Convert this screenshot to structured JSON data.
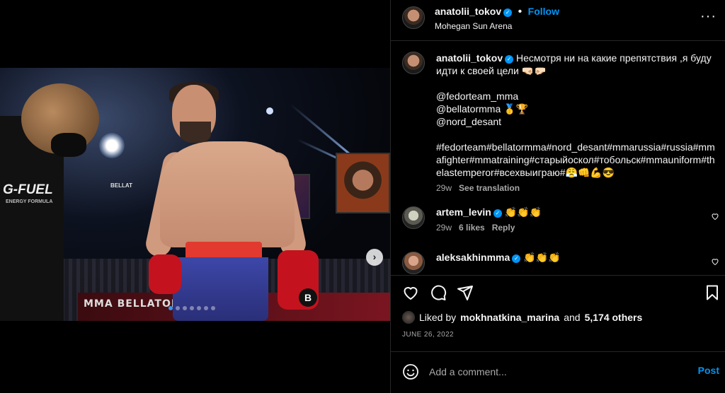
{
  "post": {
    "author": "anatolii_tokov",
    "location": "Mohegan Sun Arena",
    "follow_label": "Follow",
    "more_label": "···"
  },
  "photo": {
    "banner_text": "MMA BELLATOR MM",
    "coach_logo": "G-FUEL",
    "coach_sub": "ENERGY FORMULA",
    "arena_sign": "BELLAT",
    "glove_logo": "B",
    "next_label": "›",
    "carousel": {
      "count": 7,
      "active_index": 0
    }
  },
  "caption": {
    "author": "anatolii_tokov",
    "line1": "Несмотря ни на какие препятствия ,я буду идти к своей цели 🤜🏻🤛🏻",
    "mentions": [
      "@fedorteam_mma",
      "@bellatormma 🥇🏆",
      "@nord_desant"
    ],
    "hashtags": "#fedorteam#bellatormma#nord_desant#mmarussia#russia#mmafighter#mmatraining#старыйоскол#тобольск#mmauniform#thelastemperor#всехвыиграю#😤👊💪😎",
    "age": "29w",
    "see_translation": "See translation"
  },
  "comments": [
    {
      "user": "artem_levin",
      "text": "👏👏👏",
      "age": "29w",
      "likes": "6 likes",
      "reply": "Reply"
    },
    {
      "user": "aleksakhinmma",
      "text": "👏👏👏"
    }
  ],
  "actions": {
    "liked_by_prefix": "Liked by",
    "liked_by_user": "mokhnatkina_marina",
    "liked_by_and": "and",
    "liked_by_others": "5,174 others",
    "date": "JUNE 26, 2022"
  },
  "composer": {
    "placeholder": "Add a comment...",
    "post_label": "Post"
  },
  "colors": {
    "accent": "#0095f6",
    "background": "#000000",
    "divider": "#262626",
    "muted": "#a8a8a8"
  }
}
